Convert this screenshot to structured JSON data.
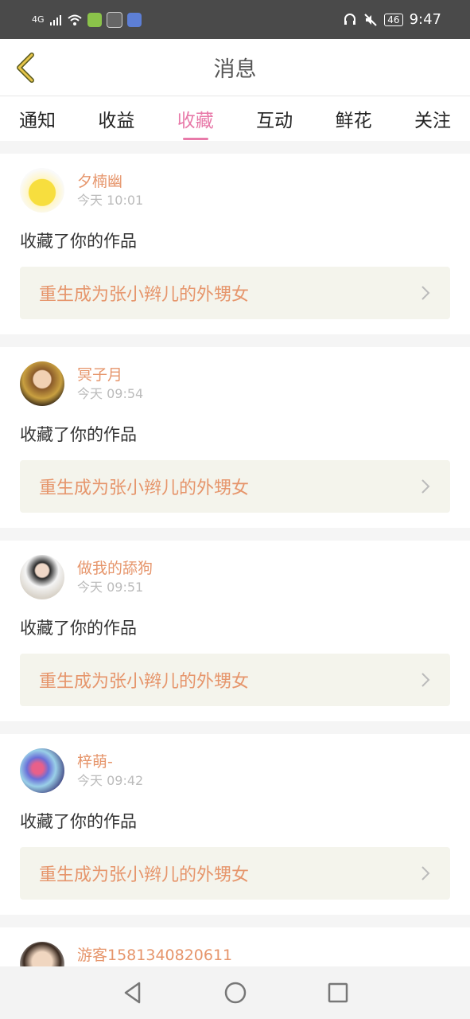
{
  "status": {
    "network": "4G",
    "battery": "46",
    "time": "9:47",
    "colors": {
      "bar": "#4a4a4a"
    }
  },
  "header": {
    "title": "消息",
    "back_icon": "back-arrow-icon"
  },
  "tabs": [
    {
      "label": "通知",
      "active": false
    },
    {
      "label": "收益",
      "active": false
    },
    {
      "label": "收藏",
      "active": true
    },
    {
      "label": "互动",
      "active": false
    },
    {
      "label": "鲜花",
      "active": false
    },
    {
      "label": "关注",
      "active": false
    }
  ],
  "messages": [
    {
      "name": "夕楠幽",
      "time": "今天 10:01",
      "action": "收藏了你的作品",
      "work": "重生成为张小辫儿的外甥女"
    },
    {
      "name": "冥子月",
      "time": "今天 09:54",
      "action": "收藏了你的作品",
      "work": "重生成为张小辫儿的外甥女"
    },
    {
      "name": "做我的舔狗",
      "time": "今天 09:51",
      "action": "收藏了你的作品",
      "work": "重生成为张小辫儿的外甥女"
    },
    {
      "name": "梓萌-",
      "time": "今天 09:42",
      "action": "收藏了你的作品",
      "work": "重生成为张小辫儿的外甥女"
    },
    {
      "name": "游客1581340820611"
    }
  ],
  "colors": {
    "accent_pink": "#e87aa9",
    "name_orange": "#e6956b",
    "work_bg": "#f4f4ec"
  }
}
